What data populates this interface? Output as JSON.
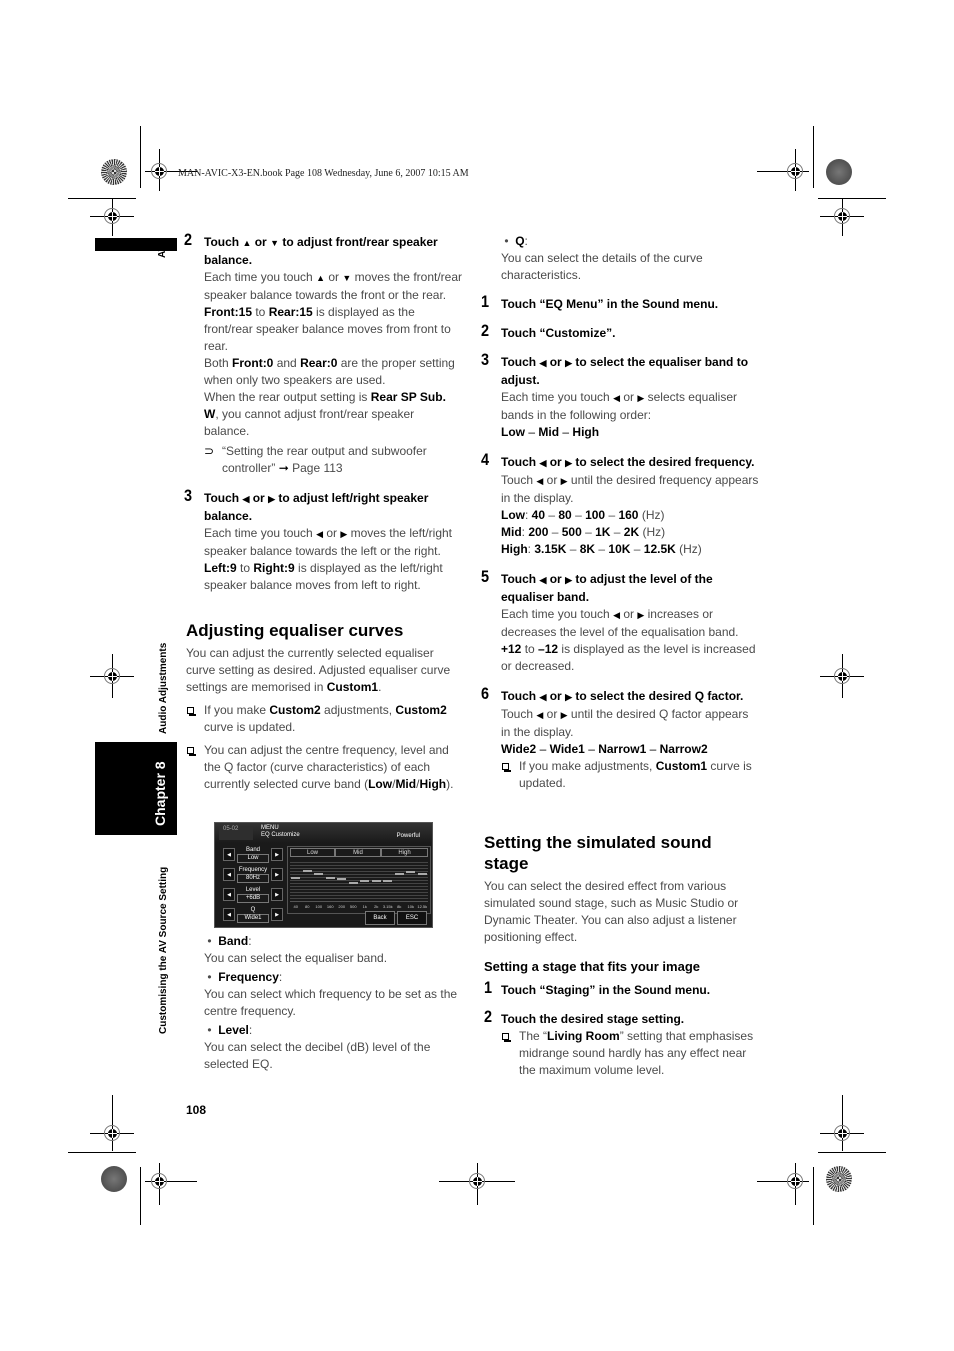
{
  "print_header": "MAN-AVIC-X3-EN.book  Page 108  Wednesday, June 6, 2007  10:15 AM",
  "side_tab": {
    "section": "AV",
    "chapter": "Chapter 8",
    "chapter_title_top": "Audio Adjustments",
    "chapter_title_bottom": "Customising the AV Source Setting"
  },
  "page_number": "108",
  "left_column": {
    "step2": {
      "num": "2",
      "title_pre": "Touch",
      "up_icon": "▲",
      "or": "or",
      "down_icon": "▼",
      "title_post": "to adjust front/rear speaker balance.",
      "p1_pre": "Each time you touch",
      "p1_mid": "or",
      "p1_post": "moves the front/rear speaker balance towards the front or the rear.",
      "p2_b1": "Front:15",
      "p2_t1": " to ",
      "p2_b2": "Rear:15",
      "p2_t2": " is displayed as the front/rear speaker balance moves from front to rear.",
      "p3_t1": "Both ",
      "p3_b1": "Front:0",
      "p3_t2": " and ",
      "p3_b2": "Rear:0",
      "p3_t3": " are the proper setting when only two speakers are used.",
      "p4_t1": "When the rear output setting is ",
      "p4_b1": "Rear SP Sub. W",
      "p4_t2": ", you cannot adjust front/rear speaker balance.",
      "xref_icon": "⊃",
      "xref_text": "“Setting the rear output and subwoofer controller”",
      "xref_arrow": "➞",
      "xref_page": "Page 113"
    },
    "step3": {
      "num": "3",
      "title_pre": "Touch",
      "left_icon": "◀",
      "or": "or",
      "right_icon": "▶",
      "title_post": "to adjust left/right speaker balance.",
      "p1_pre": "Each time you touch",
      "p1_mid": "or",
      "p1_post": "moves the left/right speaker balance towards the left or the right.",
      "p2_b1": "Left:9",
      "p2_t1": " to ",
      "p2_b2": "Right:9",
      "p2_t2": " is displayed as the left/right speaker balance moves from left to right."
    },
    "section_eq": {
      "heading": "Adjusting equaliser curves",
      "intro_t1": "You can adjust the currently selected equaliser curve setting as desired. Adjusted equaliser curve settings are memorised in ",
      "intro_b1": "Custom1",
      "intro_t2": ".",
      "note1_t1": "If you make ",
      "note1_b1": "Custom2",
      "note1_t2": " adjustments, ",
      "note1_b2": "Custom2",
      "note1_t3": " curve is updated.",
      "note2_t1": "You can adjust the centre frequency, level and the Q factor (curve characteristics) of each currently selected curve band (",
      "note2_b1": "Low",
      "note2_s1": "/",
      "note2_b2": "Mid",
      "note2_s2": "/",
      "note2_b3": "High",
      "note2_t2": ")."
    },
    "bullets": [
      {
        "label": "Band",
        "desc": "You can select the equaliser band."
      },
      {
        "label": "Frequency",
        "desc": "You can select which frequency to be set as the centre frequency."
      },
      {
        "label": "Level",
        "desc": "You can select the decibel (dB) level of the selected EQ."
      }
    ]
  },
  "eq_screen": {
    "clock": "05-02",
    "menu_title": "MENU",
    "menu_sub": "EQ Customize",
    "preset": "Powerful",
    "controls": [
      {
        "label": "Band",
        "value": "Low"
      },
      {
        "label": "Frequency",
        "value": "80Hz"
      },
      {
        "label": "Level",
        "value": "+6dB"
      },
      {
        "label": "Q",
        "value": "Wide1"
      }
    ],
    "arrow_left": "◀",
    "arrow_right": "▶",
    "band_headers": [
      "Low",
      "Mid",
      "High"
    ],
    "freq_labels": [
      "40",
      "80",
      "100",
      "160",
      "200",
      "500",
      "1k",
      "2k",
      "3.15k",
      "8k",
      "10k",
      "12.5k"
    ],
    "levels_db": [
      2,
      6,
      4,
      2,
      1,
      -1,
      0,
      0,
      0,
      4,
      5,
      4
    ],
    "back_label": "Back",
    "esc_label": "ESC"
  },
  "right_column": {
    "bullet_q": {
      "label": "Q",
      "desc": "You can select the details of the curve characteristics."
    },
    "step1": {
      "num": "1",
      "title": "Touch “EQ Menu” in the Sound menu."
    },
    "step2": {
      "num": "2",
      "title": "Touch “Customize”."
    },
    "step3": {
      "num": "3",
      "title_pre": "Touch",
      "left_icon": "◀",
      "or": "or",
      "right_icon": "▶",
      "title_post": "to select the equaliser band to adjust.",
      "p1_pre": "Each time you touch",
      "p1_mid": "or",
      "p1_post": "selects equaliser bands in the following order:",
      "order": [
        "Low",
        "Mid",
        "High"
      ]
    },
    "step4": {
      "num": "4",
      "title_pre": "Touch",
      "left_icon": "◀",
      "or": "or",
      "right_icon": "▶",
      "title_post": "to select the desired frequency.",
      "p1_pre": "Touch",
      "p1_mid": "or",
      "p1_post": "until the desired frequency appears in the display.",
      "freq_rows": [
        {
          "band": "Low",
          "values": [
            "40",
            "80",
            "100",
            "160"
          ],
          "unit": "(Hz)"
        },
        {
          "band": "Mid",
          "values": [
            "200",
            "500",
            "1K",
            "2K"
          ],
          "unit": "(Hz)"
        },
        {
          "band": "High",
          "values": [
            "3.15K",
            "8K",
            "10K",
            "12.5K"
          ],
          "unit": "(Hz)"
        }
      ]
    },
    "step5": {
      "num": "5",
      "title_pre": "Touch",
      "left_icon": "◀",
      "or": "or",
      "right_icon": "▶",
      "title_post": "to adjust the level of the equaliser band.",
      "p1_pre": "Each time you touch",
      "p1_mid": "or",
      "p1_post": "increases or decreases the level of the equalisation band.",
      "p2_b1": "+12",
      "p2_t1": " to ",
      "p2_b2": "–12",
      "p2_t2": " is displayed as the level is increased or decreased."
    },
    "step6": {
      "num": "6",
      "title_pre": "Touch",
      "left_icon": "◀",
      "or": "or",
      "right_icon": "▶",
      "title_post": "to select the desired Q factor.",
      "p1_pre": "Touch",
      "p1_mid": "or",
      "p1_post": "until the desired Q factor appears in the display.",
      "order": [
        "Wide2",
        "Wide1",
        "Narrow1",
        "Narrow2"
      ],
      "note_t1": "If you make adjustments, ",
      "note_b1": "Custom1",
      "note_t2": " curve is updated."
    },
    "section_stage": {
      "heading": "Setting the simulated sound stage",
      "intro": "You can select the desired effect from various simulated sound stage, such as Music Studio or Dynamic Theater. You can also adjust a listener positioning effect.",
      "subheading": "Setting a stage that fits your image",
      "step1": {
        "num": "1",
        "title": "Touch “Staging” in the Sound menu."
      },
      "step2": {
        "num": "2",
        "title": "Touch the desired stage setting."
      },
      "note_t1": "The “",
      "note_b1": "Living Room",
      "note_t2": "” setting that emphasises midrange sound hardly has any effect near the maximum volume level."
    }
  }
}
